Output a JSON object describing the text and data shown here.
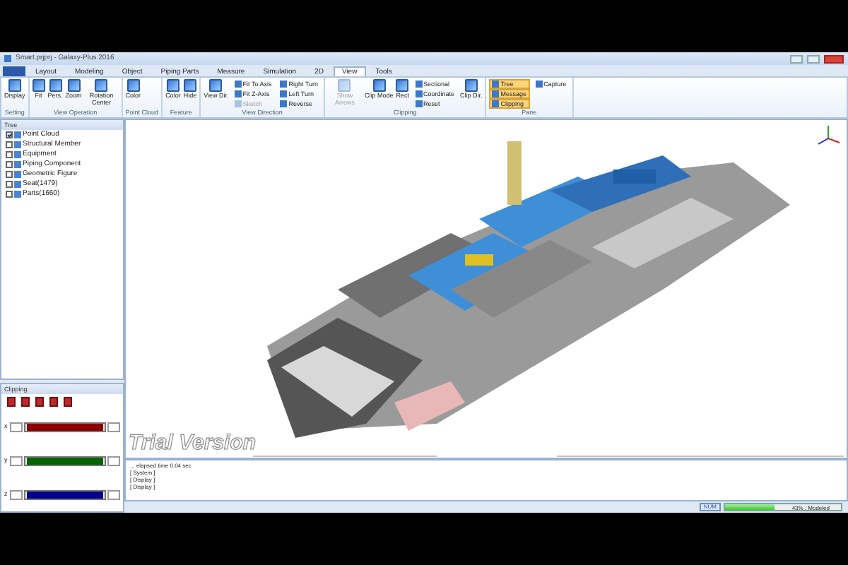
{
  "window": {
    "title": "Smart.prjprj - Galaxy-Plus 2016"
  },
  "ribbon": {
    "tabs": [
      {
        "label": "Layout",
        "selected": false
      },
      {
        "label": "Modeling",
        "selected": false
      },
      {
        "label": "Object",
        "selected": false
      },
      {
        "label": "Piping Parts",
        "selected": false
      },
      {
        "label": "Measure",
        "selected": false
      },
      {
        "label": "Simulation",
        "selected": false
      },
      {
        "label": "2D",
        "selected": false
      },
      {
        "label": "View",
        "selected": true
      },
      {
        "label": "Tools",
        "selected": false
      }
    ],
    "groups": [
      {
        "label": "Setting",
        "items": [
          {
            "kind": "large",
            "label": "Display",
            "disabled": false,
            "on": false
          }
        ]
      },
      {
        "label": "View Operation",
        "items": [
          {
            "kind": "large",
            "label": "Fit",
            "disabled": false,
            "on": false
          },
          {
            "kind": "large",
            "label": "Pers.",
            "disabled": false,
            "on": false
          },
          {
            "kind": "large",
            "label": "Zoom",
            "disabled": false,
            "on": false
          },
          {
            "kind": "large",
            "label": "Rotation Center",
            "disabled": false,
            "on": false
          }
        ]
      },
      {
        "label": "Point Cloud",
        "items": [
          {
            "kind": "large",
            "label": "Color",
            "disabled": false,
            "on": false
          }
        ]
      },
      {
        "label": "Feature",
        "items": [
          {
            "kind": "large",
            "label": "Color",
            "disabled": false,
            "on": false
          },
          {
            "kind": "large",
            "label": "Hide",
            "disabled": false,
            "on": false
          }
        ]
      },
      {
        "label": "View Direction",
        "items": [
          {
            "kind": "large",
            "label": "View Dir.",
            "disabled": false,
            "on": false
          },
          {
            "kind": "small",
            "label": "Fit To Axis",
            "disabled": false,
            "on": false
          },
          {
            "kind": "small",
            "label": "Fit Z-Axis",
            "disabled": false,
            "on": false
          },
          {
            "kind": "small",
            "label": "Sketch",
            "disabled": true,
            "on": false
          },
          {
            "kind": "small",
            "label": "Right Turn",
            "disabled": false,
            "on": false
          },
          {
            "kind": "small",
            "label": "Left Turn",
            "disabled": false,
            "on": false
          },
          {
            "kind": "small",
            "label": "Reverse",
            "disabled": false,
            "on": false
          }
        ]
      },
      {
        "label": "Clipping",
        "items": [
          {
            "kind": "large",
            "label": "Show Arrows",
            "disabled": true,
            "on": false
          },
          {
            "kind": "large",
            "label": "Clip Mode",
            "disabled": false,
            "on": false
          },
          {
            "kind": "large",
            "label": "Rect",
            "disabled": false,
            "on": false
          },
          {
            "kind": "small",
            "label": "Sectional",
            "disabled": false,
            "on": false
          },
          {
            "kind": "small",
            "label": "Coordinate",
            "disabled": false,
            "on": false
          },
          {
            "kind": "small",
            "label": "Reset",
            "disabled": false,
            "on": false
          },
          {
            "kind": "large",
            "label": "Clip Dir.",
            "disabled": false,
            "on": false
          }
        ]
      },
      {
        "label": "Pane",
        "items": [
          {
            "kind": "small",
            "label": "Tree",
            "disabled": false,
            "on": true
          },
          {
            "kind": "small",
            "label": "Message",
            "disabled": false,
            "on": true
          },
          {
            "kind": "small",
            "label": "Clipping",
            "disabled": false,
            "on": true
          },
          {
            "kind": "small",
            "label": "Capture",
            "disabled": false,
            "on": false
          }
        ]
      }
    ]
  },
  "tree": {
    "title": "Tree",
    "items": [
      {
        "label": "Point Cloud",
        "checked": true
      },
      {
        "label": "Structural Member",
        "checked": false
      },
      {
        "label": "Equipment",
        "checked": false
      },
      {
        "label": "Piping Component",
        "checked": false
      },
      {
        "label": "Geometric Figure",
        "checked": false
      },
      {
        "label": "Seat(1479)",
        "checked": false
      },
      {
        "label": "Parts(1660)",
        "checked": false
      }
    ]
  },
  "clipping": {
    "title": "Clipping",
    "sliders": [
      {
        "axis": "x",
        "color": "#8b0000"
      },
      {
        "axis": "y",
        "color": "#006400"
      },
      {
        "axis": "z",
        "color": "#00008b"
      }
    ]
  },
  "viewport": {
    "watermark": "Trial Version"
  },
  "messages": {
    "lines": [
      "... elapsed time 0.04 sec",
      "[ System ]",
      "[ Display ]",
      "[ Display ]"
    ]
  },
  "status_bar": {
    "indicator": "NUM",
    "progress": {
      "level": 0.43,
      "text": "43% : Modeled"
    }
  }
}
